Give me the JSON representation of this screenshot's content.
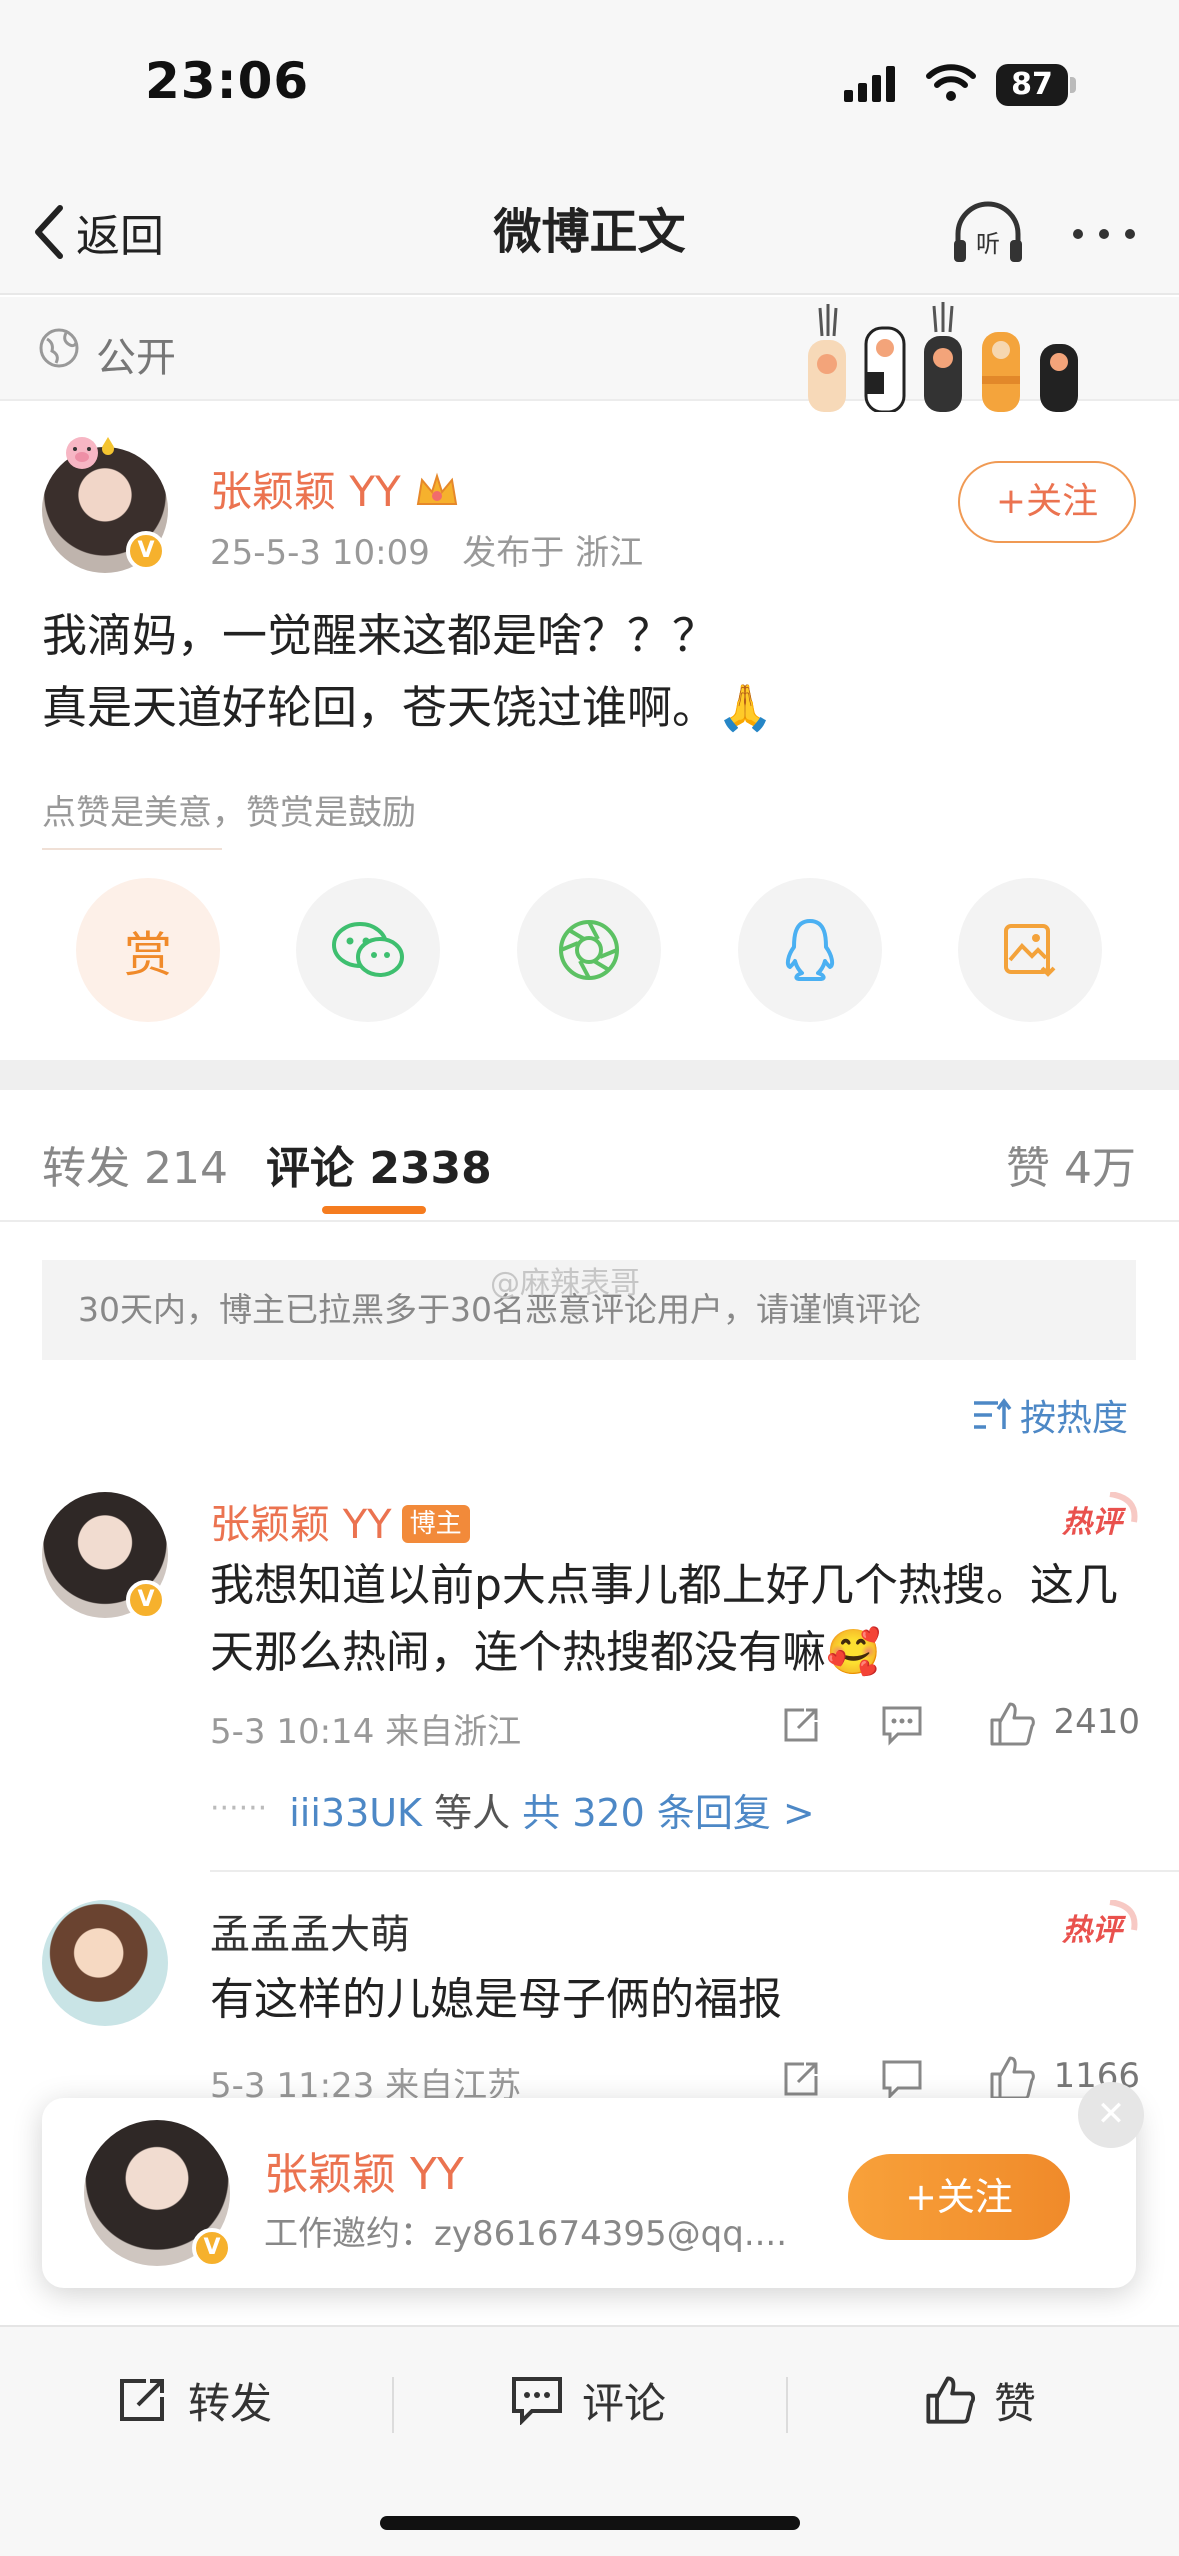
{
  "status_bar": {
    "time": "23:06",
    "battery": "87"
  },
  "nav": {
    "back_label": "返回",
    "title": "微博正文"
  },
  "post": {
    "visibility": "公开",
    "author": "张颖颖 YY",
    "time": "25-5-3 10:09",
    "location": "发布于 浙江",
    "follow_label": "+关注",
    "text_line1": "我滴妈，一觉醒来这都是啥？？？",
    "text_line2": "真是天道好轮回，苍天饶过谁啊。🙏",
    "praise_hint": "点赞是美意，赞赏是鼓励",
    "reward_label": "赏"
  },
  "tabs": {
    "repost_label": "转发",
    "repost_count": "214",
    "comment_label": "评论",
    "comment_count": "2338",
    "like_label": "赞",
    "like_count": "4万"
  },
  "notice": "30天内，博主已拉黑多于30名恶意评论用户，请谨慎评论",
  "watermark": "@麻辣表哥",
  "sort_label": "按热度",
  "comments": [
    {
      "name": "张颖颖 YY",
      "badge": "博主",
      "hot": "热评",
      "text": "我想知道以前p大点事儿都上好几个热搜。这几天那么热闹，连个热搜都没有嘛🥰",
      "meta": "5-3 10:14  来自浙江",
      "likes": "2410",
      "replies_user": "iii33UK",
      "replies_mid": " 等人 ",
      "replies_count": "共 320 条回复 >"
    },
    {
      "name": "孟孟孟大萌",
      "hot": "热评",
      "text": "有这样的儿媳是母子俩的福报",
      "meta": "5-3 11:23  来自江苏",
      "likes": "1166"
    }
  ],
  "popup": {
    "name": "张颖颖 YY",
    "subtitle": "工作邀约：zy861674395@qq....",
    "follow_label": "+关注"
  },
  "bottom_bar": {
    "repost": "转发",
    "comment": "评论",
    "like": "赞"
  },
  "colors": {
    "accent": "#eb7350",
    "link": "#4d88c6",
    "orange": "#f57c1f"
  }
}
